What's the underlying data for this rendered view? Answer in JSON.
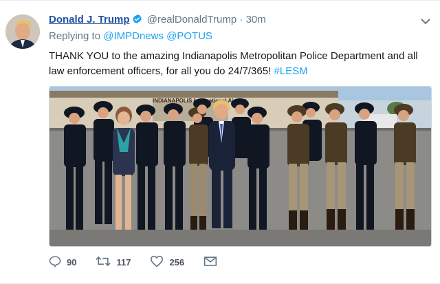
{
  "tweet": {
    "author_name": "Donald J. Trump",
    "author_handle": "@realDonaldTrump",
    "separator": "·",
    "time": "30m",
    "reply_prefix": "Replying to",
    "reply_mentions": [
      "@IMPDnews",
      "@POTUS"
    ],
    "text_main": "THANK YOU to the amazing Indianapolis Metropolitan Police Department and all law enforcement officers, for all you do 24/7/365!",
    "hashtag": "#LESM",
    "building_sign": "INDIANAPOLIS International Airport"
  },
  "actions": {
    "reply_count": "90",
    "retweet_count": "117",
    "like_count": "256"
  },
  "icons": {
    "verified": "verified-badge-icon",
    "menu": "chevron-down-icon",
    "reply": "reply-icon",
    "retweet": "retweet-icon",
    "like": "heart-icon",
    "dm": "envelope-icon"
  },
  "colors": {
    "name": "#1f4fa0",
    "link": "#1da1f2",
    "muted": "#657786",
    "verified": "#1da1f2"
  }
}
